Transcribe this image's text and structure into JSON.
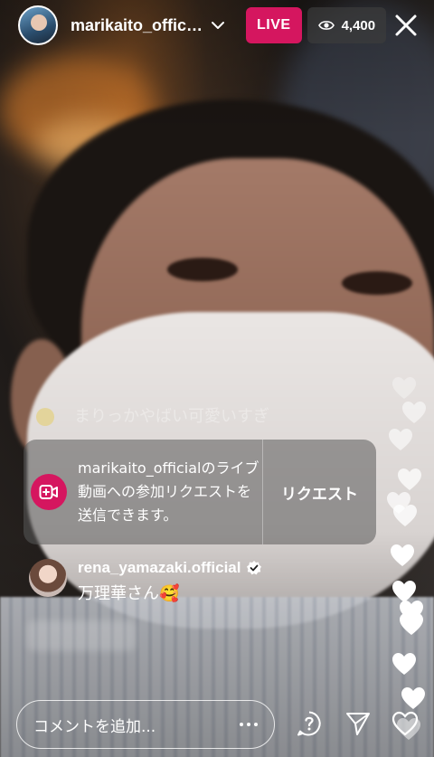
{
  "header": {
    "username": "marikaito_offici...",
    "live_label": "LIVE",
    "viewer_count": "4,400"
  },
  "comments": {
    "faded": "まりっかやばい可愛いすぎ",
    "join_request": {
      "message": "marikaito_officialのライブ動画への参加リクエストを送信できます。",
      "button_label": "リクエスト"
    },
    "latest": {
      "username": "rena_yamazaki.official",
      "text": "万理華さん🥰"
    }
  },
  "footer": {
    "comment_placeholder": "コメントを追加..."
  },
  "colors": {
    "live_badge": "#d5165f",
    "request_icon": "#d5165f",
    "viewer_badge": "rgba(60,60,60,0.7)"
  },
  "icons": [
    "chevron-down-icon",
    "eye-icon",
    "close-icon",
    "video-add-icon",
    "verified-icon",
    "more-dots-icon",
    "question-icon",
    "send-icon",
    "heart-icon"
  ]
}
